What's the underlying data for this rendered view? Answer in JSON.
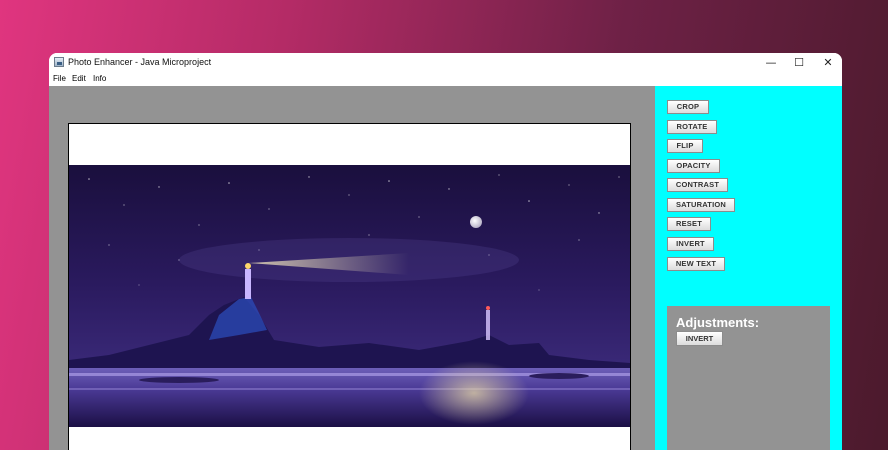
{
  "window": {
    "title": "Photo Enhancer - Java Microproject",
    "controls": {
      "minimize": "—",
      "maximize": "☐",
      "close": "✕"
    }
  },
  "menu": {
    "items": [
      "File",
      "Edit",
      "Info"
    ]
  },
  "tools": {
    "buttons": [
      "CROP",
      "ROTATE",
      "FLIP",
      "OPACITY",
      "CONTRAST",
      "SATURATION",
      "RESET",
      "INVERT",
      "NEW TEXT"
    ]
  },
  "adjustments": {
    "title": "Adjustments:",
    "button": "INVERT"
  },
  "colors": {
    "canvas_bg": "#939393",
    "side_panel_bg": "#00ffff",
    "adjust_panel_bg": "#939393"
  },
  "image": {
    "scene": "night-lighthouse-landscape"
  }
}
